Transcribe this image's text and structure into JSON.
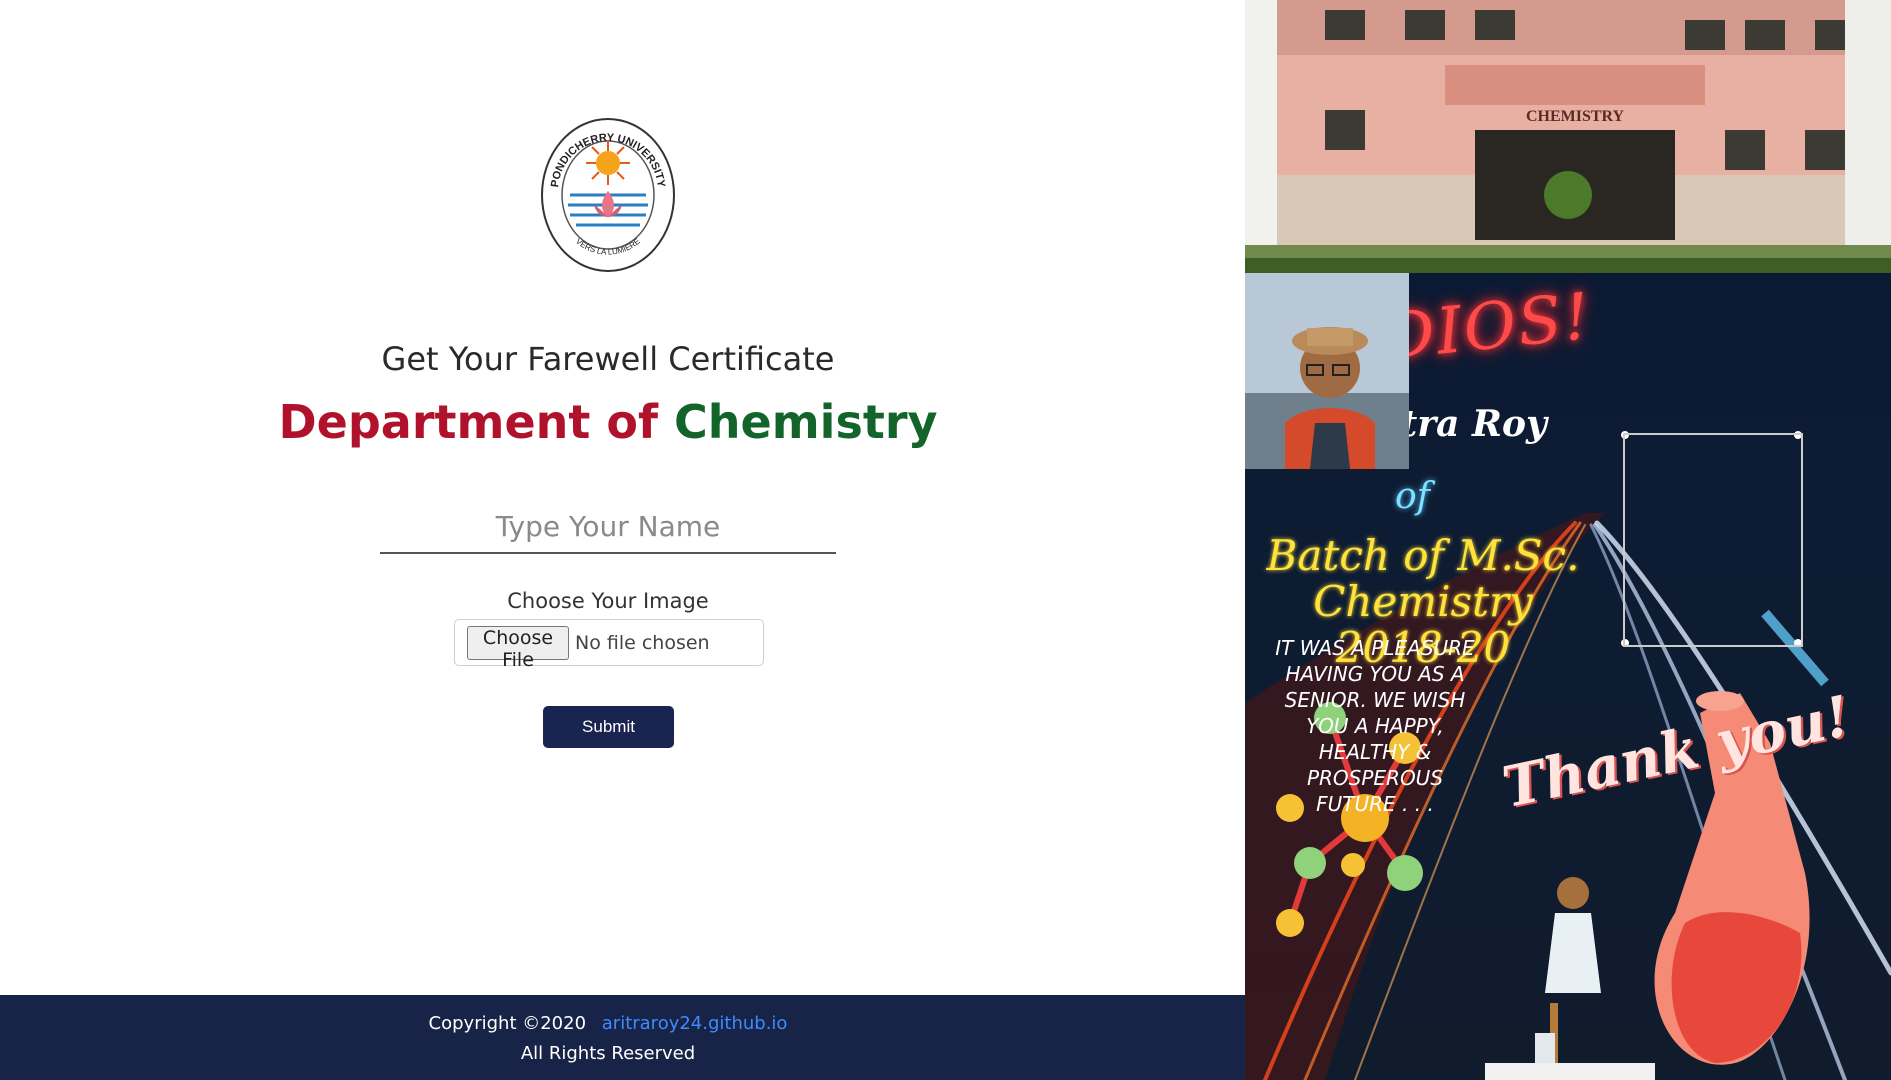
{
  "form": {
    "heading": "Get Your Farewell Certificate",
    "dept_prefix": "Department of",
    "dept_name": "Chemistry",
    "name_placeholder": "Type Your Name",
    "image_label": "Choose Your Image",
    "file_button": "Choose File",
    "file_status": "No file chosen",
    "submit": "Submit"
  },
  "logo": {
    "top_text": "PONDICHERRY UNIVERSITY",
    "bottom_text": "VERS LA LUMIERE"
  },
  "footer": {
    "copyright": "Copyright ©2020",
    "link": "aritraroy24.github.io",
    "rights": "All Rights Reserved"
  },
  "preview": {
    "building_sign": "CHEMISTRY",
    "adios": "ADIOS!",
    "name": "Aritra Roy",
    "of": "of",
    "batch": "Batch of M.Sc. Chemistry 2018-20",
    "message": "IT WAS A PLEASURE HAVING YOU AS A SENIOR. WE WISH YOU A HAPPY, HEALTHY & PROSPEROUS FUTURE . . .",
    "thanks": "Thank you!"
  },
  "colors": {
    "dept_prefix": "#b0122b",
    "dept_name": "#12642a",
    "button_bg": "#192450",
    "footer_bg": "#182348",
    "link": "#3d8bfd"
  }
}
